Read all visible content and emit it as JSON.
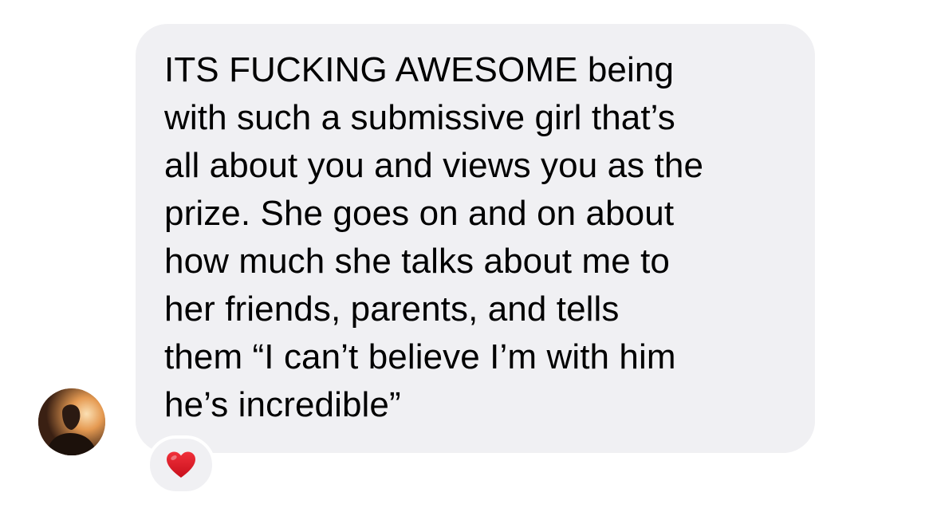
{
  "message": {
    "lines": [
      "ITS FUCKING AWESOME being",
      "with such a submissive girl that’s",
      "all about you and views you as the",
      "prize. She goes on and on about",
      "how much she talks about me to",
      "her friends, parents, and tells",
      "them “I can’t believe I’m with him",
      "he’s incredible”"
    ],
    "bubble_color": "#f0f0f3",
    "text_color": "#000000"
  },
  "reaction": {
    "icon": "red-heart-icon",
    "color": "#e0202a"
  },
  "sender": {
    "avatar_icon": "avatar"
  }
}
